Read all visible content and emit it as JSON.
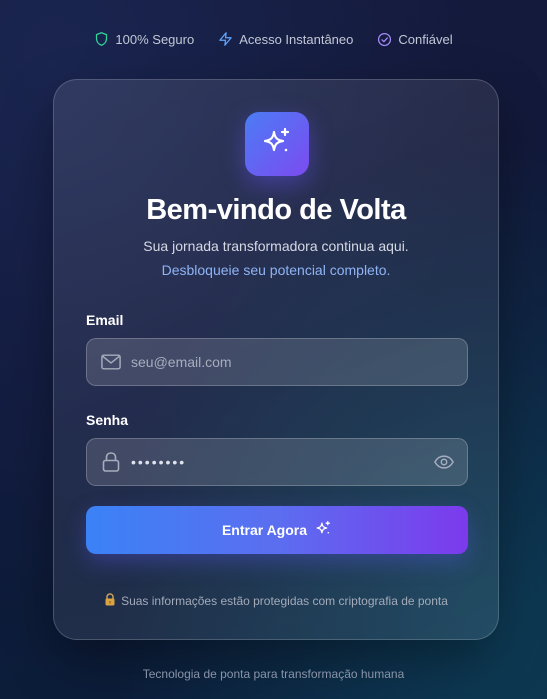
{
  "trust_badges": [
    {
      "label": "100% Seguro",
      "icon": "shield-icon",
      "color": "#34d399"
    },
    {
      "label": "Acesso Instantâneo",
      "icon": "lightning-icon",
      "color": "#60a5fa"
    },
    {
      "label": "Confiável",
      "icon": "check-circle-icon",
      "color": "#a78bfa"
    }
  ],
  "card": {
    "logo_icon": "sparkles-icon",
    "title": "Bem-vindo de Volta",
    "subtitle": "Sua jornada transformadora continua aqui.",
    "subtitle_highlight": "Desbloqueie seu potencial completo.",
    "email": {
      "label": "Email",
      "icon": "mail-icon",
      "placeholder": "seu@email.com",
      "value": ""
    },
    "password": {
      "label": "Senha",
      "icon": "lock-icon",
      "value": "••••••••",
      "toggle_icon": "eye-icon"
    },
    "submit": {
      "label": "Entrar Agora",
      "icon": "sparkles-icon"
    },
    "security_note": {
      "icon": "lock-emoji-icon",
      "text": "Suas informações estão protegidas com criptografia de ponta"
    }
  },
  "footer": {
    "text": "Tecnologia de ponta para transformação humana"
  },
  "colors": {
    "accent_blue": "#3b82f6",
    "accent_purple": "#7c3aed",
    "link_blue": "#8fb4f5",
    "background": "#121a3a"
  }
}
